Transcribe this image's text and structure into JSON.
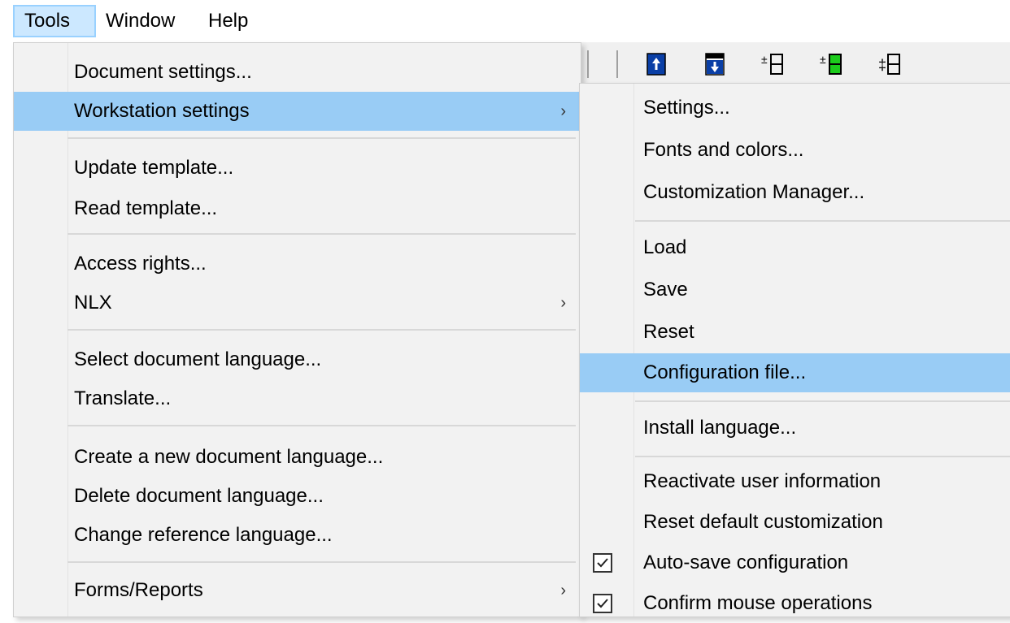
{
  "menubar": {
    "items": [
      {
        "label": "Tools"
      },
      {
        "label": "Window"
      },
      {
        "label": "Help"
      }
    ]
  },
  "toolbar": {
    "icons": [
      "move-up-icon",
      "move-down-icon",
      "plus-minus-row-icon",
      "plus-minus-row-green-icon",
      "insert-row-icon"
    ],
    "colors": {
      "blue": "#0a3fa6",
      "green": "#1ccc1c"
    }
  },
  "tools_menu": {
    "items": [
      {
        "label": "Document settings..."
      },
      {
        "label": "Workstation settings",
        "submenu": true,
        "highlighted": true
      },
      {
        "label": "Update template..."
      },
      {
        "label": "Read template..."
      },
      {
        "label": "Access rights..."
      },
      {
        "label": "NLX",
        "submenu": true
      },
      {
        "label": "Select document language..."
      },
      {
        "label": "Translate..."
      },
      {
        "label": "Create a new document language..."
      },
      {
        "label": "Delete document language..."
      },
      {
        "label": "Change reference language..."
      },
      {
        "label": "Forms/Reports",
        "submenu": true
      }
    ],
    "arrow_glyph": "›"
  },
  "workstation_submenu": {
    "items": [
      {
        "label": "Settings..."
      },
      {
        "label": "Fonts and colors..."
      },
      {
        "label": "Customization Manager..."
      },
      {
        "label": "Load"
      },
      {
        "label": "Save"
      },
      {
        "label": "Reset"
      },
      {
        "label": "Configuration file...",
        "highlighted": true
      },
      {
        "label": "Install language..."
      },
      {
        "label": "Reactivate user information"
      },
      {
        "label": "Reset default customization"
      },
      {
        "label": "Auto-save configuration",
        "checked": true
      },
      {
        "label": "Confirm mouse operations",
        "checked": true
      }
    ]
  },
  "colors": {
    "highlight": "#99ccf5",
    "menu_bg": "#f2f2f2",
    "menubar_active": "#cce8ff"
  }
}
